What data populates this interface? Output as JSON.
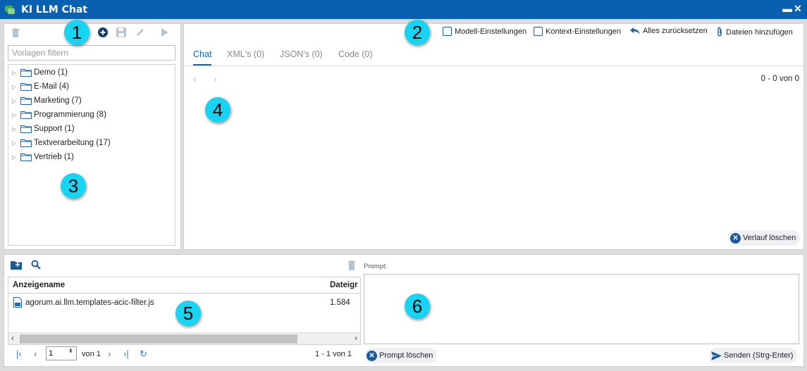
{
  "window": {
    "title": "KI LLM Chat"
  },
  "templates": {
    "filter_placeholder": "Vorlagen filtern",
    "folders": [
      {
        "label": "Demo (1)"
      },
      {
        "label": "E-Mail (4)"
      },
      {
        "label": "Marketing (7)"
      },
      {
        "label": "Programmierung (8)"
      },
      {
        "label": "Support (1)"
      },
      {
        "label": "Textverarbeitung (17)"
      },
      {
        "label": "Vertrieb (1)"
      }
    ]
  },
  "options": {
    "model_settings": "Modell-Einstellungen",
    "context_settings": "Kontext-Einstellungen",
    "reset_all": "Alles zurücksetzen",
    "add_files": "Dateien hinzufügen"
  },
  "tabs": [
    {
      "label": "Chat",
      "active": true
    },
    {
      "label": "XML's (0)"
    },
    {
      "label": "JSON's (0)"
    },
    {
      "label": "Code (0)"
    }
  ],
  "chat": {
    "range": "0 - 0 von 0",
    "clear_history": "Verlauf löschen"
  },
  "files": {
    "columns": [
      "Anzeigename",
      "Dateigr"
    ],
    "rows": [
      {
        "name": "agorum.ai.llm.templates-acic-filter.js",
        "size": "1.584"
      }
    ],
    "pager": {
      "page": "1",
      "of_label": "von 1",
      "range": "1 - 1 von 1"
    }
  },
  "prompt": {
    "label": "Prompt:",
    "clear": "Prompt löschen",
    "send": "Senden (Strg-Enter)"
  },
  "badges": [
    "1",
    "2",
    "3",
    "4",
    "5",
    "6"
  ],
  "colors": {
    "titlebar": "#0a60b0",
    "accent": "#1565c0",
    "badge": "#16d4f2",
    "icon": "#1e5a9a"
  }
}
